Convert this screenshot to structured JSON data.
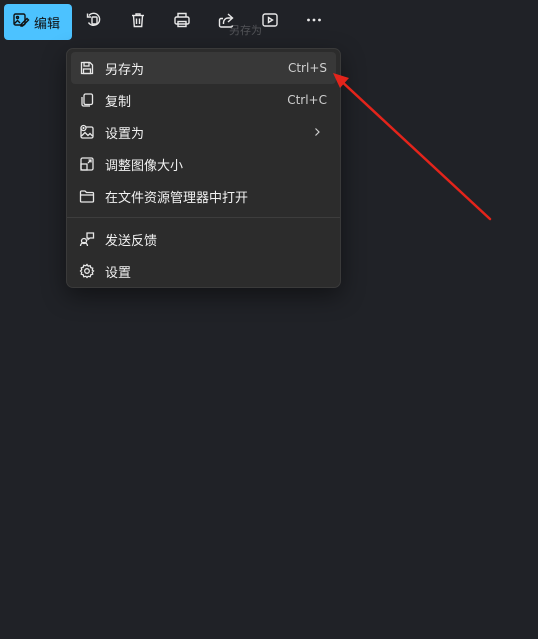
{
  "toolbar": {
    "edit_label": "编辑",
    "tooltip_text": "另存为",
    "buttons": {
      "rotate_icon": "rotate-icon",
      "delete_icon": "trash-icon",
      "print_icon": "print-icon",
      "share_icon": "share-icon",
      "slideshow_icon": "play-icon",
      "more_icon": "more-icon"
    }
  },
  "menu": {
    "items": [
      {
        "label": "另存为",
        "shortcut": "Ctrl+S",
        "icon": "save-icon"
      },
      {
        "label": "复制",
        "shortcut": "Ctrl+C",
        "icon": "copy-icon"
      },
      {
        "label": "设置为",
        "icon": "set-as-icon"
      },
      {
        "label": "调整图像大小",
        "icon": "resize-icon"
      },
      {
        "label": "在文件资源管理器中打开",
        "icon": "folder-icon"
      },
      {
        "label": "发送反馈",
        "icon": "feedback-icon"
      },
      {
        "label": "设置",
        "icon": "gear-icon"
      }
    ]
  },
  "colors": {
    "background": "#202227",
    "accent": "#4cc2ff",
    "menu_background": "#2c2c2c",
    "annotation_arrow": "#e3241b"
  }
}
